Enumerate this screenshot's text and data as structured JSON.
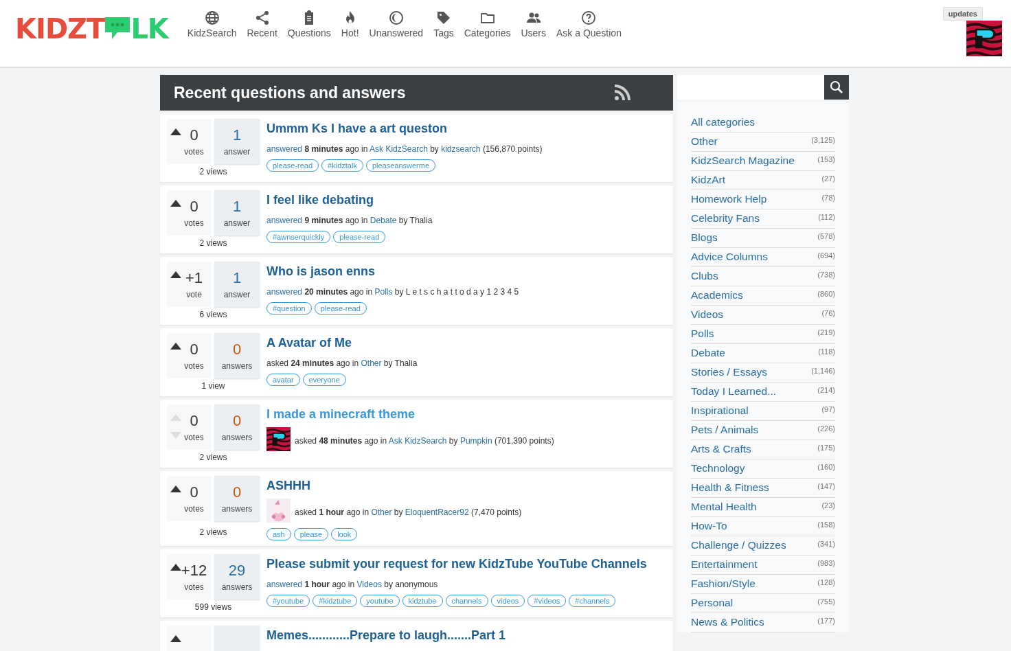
{
  "logo": {
    "left": "KIDZT",
    "right": "LK"
  },
  "nav": [
    {
      "label": "KidzSearch",
      "kind": "globe"
    },
    {
      "label": "Recent",
      "kind": "share"
    },
    {
      "label": "Questions",
      "kind": "clipboard"
    },
    {
      "label": "Hot!",
      "kind": "fire"
    },
    {
      "label": "Unanswered",
      "kind": "moon"
    },
    {
      "label": "Tags",
      "kind": "tag"
    },
    {
      "label": "Categories",
      "kind": "folder"
    },
    {
      "label": "Users",
      "kind": "users"
    },
    {
      "label": "Ask a Question",
      "kind": "question"
    }
  ],
  "updates_button": "updates",
  "user_avatar": {
    "kind": "picture"
  },
  "heading": "Recent questions and answers",
  "questions": [
    {
      "votes": "0",
      "votes_label": "votes",
      "voting_enabled": true,
      "answers": "1",
      "answers_label": "answer",
      "answered": true,
      "views": "2 views",
      "title": "Ummm Ks I have a art queston",
      "visited": false,
      "meta": [
        {
          "text": "answered",
          "kind": "link"
        },
        {
          "text": "8 minutes",
          "kind": "bold"
        },
        {
          "text": "ago in",
          "kind": "plain"
        },
        {
          "text": "Ask KidzSearch",
          "kind": "link"
        },
        {
          "text": "by",
          "kind": "plain"
        },
        {
          "text": "kidzsearch",
          "kind": "link"
        },
        {
          "text": "(156,870 points)",
          "kind": "plain"
        }
      ],
      "tags": [
        "please-read",
        "#kidztalk",
        "pleaseanswerme"
      ]
    },
    {
      "votes": "0",
      "votes_label": "votes",
      "voting_enabled": true,
      "answers": "1",
      "answers_label": "answer",
      "answered": true,
      "views": "2 views",
      "title": "I feel like debating",
      "visited": false,
      "meta": [
        {
          "text": "answered",
          "kind": "link"
        },
        {
          "text": "9 minutes",
          "kind": "bold"
        },
        {
          "text": "ago in",
          "kind": "plain"
        },
        {
          "text": "Debate",
          "kind": "link"
        },
        {
          "text": "by Thalia",
          "kind": "plain"
        }
      ],
      "tags": [
        "#awnserquickly",
        "please-read"
      ]
    },
    {
      "votes": "+1",
      "votes_label": "vote",
      "voting_enabled": true,
      "answers": "1",
      "answers_label": "answer",
      "answered": true,
      "views": "6 views",
      "title": "Who is jason enns",
      "visited": false,
      "meta": [
        {
          "text": "answered",
          "kind": "link"
        },
        {
          "text": "20 minutes",
          "kind": "bold"
        },
        {
          "text": "ago in",
          "kind": "plain"
        },
        {
          "text": "Polls",
          "kind": "link"
        },
        {
          "text": "by L e t s c h a t t o d a y 1 2 3 4 5",
          "kind": "plain"
        }
      ],
      "tags": [
        "#question",
        "please-read"
      ]
    },
    {
      "votes": "0",
      "votes_label": "votes",
      "voting_enabled": true,
      "answers": "0",
      "answers_label": "answers",
      "answered": false,
      "views": "1 view",
      "title": "A Avatar of Me",
      "visited": false,
      "meta": [
        {
          "text": "asked",
          "kind": "plain"
        },
        {
          "text": "24 minutes",
          "kind": "bold"
        },
        {
          "text": "ago in",
          "kind": "plain"
        },
        {
          "text": "Other",
          "kind": "link"
        },
        {
          "text": "by Thalia",
          "kind": "plain"
        }
      ],
      "tags": [
        "avatar",
        "everyone"
      ]
    },
    {
      "votes": "0",
      "votes_label": "votes",
      "voting_enabled": false,
      "answers": "0",
      "answers_label": "answers",
      "answered": false,
      "views": "2 views",
      "title": "I made a minecraft theme",
      "visited": true,
      "avatar": {
        "kind": "picture"
      },
      "meta": [
        {
          "text": "asked",
          "kind": "plain"
        },
        {
          "text": "48 minutes",
          "kind": "bold"
        },
        {
          "text": "ago in",
          "kind": "plain"
        },
        {
          "text": "Ask KidzSearch",
          "kind": "link"
        },
        {
          "text": "by",
          "kind": "plain"
        },
        {
          "text": "Pumpkin",
          "kind": "link"
        },
        {
          "text": "(701,390 points)",
          "kind": "plain"
        }
      ]
    },
    {
      "votes": "0",
      "votes_label": "votes",
      "voting_enabled": true,
      "answers": "0",
      "answers_label": "answers",
      "answered": false,
      "views": "2 views",
      "title": "ASHHH",
      "visited": false,
      "avatar": {
        "kind": "picture"
      },
      "meta": [
        {
          "text": "asked",
          "kind": "plain"
        },
        {
          "text": "1 hour",
          "kind": "bold"
        },
        {
          "text": "ago in",
          "kind": "plain"
        },
        {
          "text": "Other",
          "kind": "link"
        },
        {
          "text": "by",
          "kind": "plain"
        },
        {
          "text": "EloquentRacer92",
          "kind": "link"
        },
        {
          "text": "(7,470 points)",
          "kind": "plain"
        }
      ],
      "tags": [
        "ash",
        "please",
        "look"
      ]
    },
    {
      "votes": "+12",
      "votes_label": "votes",
      "voting_enabled": true,
      "answers": "29",
      "answers_label": "answers",
      "answered": true,
      "views": "599 views",
      "title": "Please submit your request for new KidzTube YouTube Channels",
      "visited": false,
      "meta": [
        {
          "text": "answered",
          "kind": "link"
        },
        {
          "text": "1 hour",
          "kind": "bold"
        },
        {
          "text": "ago in",
          "kind": "plain"
        },
        {
          "text": "Videos",
          "kind": "link"
        },
        {
          "text": "by anonymous",
          "kind": "plain"
        }
      ],
      "tags": [
        "#youtube",
        "#kidztube",
        "youtube",
        "kidztube",
        "channels",
        "videos",
        "#videos",
        "#channels"
      ]
    },
    {
      "voting_enabled": true,
      "title": "Memes............Prepare to laugh.......Part 1",
      "visited": false
    }
  ],
  "categories": [
    {
      "label": "All categories"
    },
    {
      "label": "Other",
      "count": "(3,125)"
    },
    {
      "label": "KidzSearch Magazine",
      "count": "(153)"
    },
    {
      "label": "KidzArt",
      "count": "(27)"
    },
    {
      "label": "Homework Help",
      "count": "(78)"
    },
    {
      "label": "Celebrity Fans",
      "count": "(112)"
    },
    {
      "label": "Blogs",
      "count": "(578)"
    },
    {
      "label": "Advice Columns",
      "count": "(694)"
    },
    {
      "label": "Clubs",
      "count": "(738)"
    },
    {
      "label": "Academics",
      "count": "(860)"
    },
    {
      "label": "Videos",
      "count": "(76)"
    },
    {
      "label": "Polls",
      "count": "(219)"
    },
    {
      "label": "Debate",
      "count": "(118)"
    },
    {
      "label": "Stories / Essays",
      "count": "(1,146)"
    },
    {
      "label": "Today I Learned...",
      "count": "(214)"
    },
    {
      "label": "Inspirational",
      "count": "(97)"
    },
    {
      "label": "Pets / Animals",
      "count": "(226)"
    },
    {
      "label": "Arts & Crafts",
      "count": "(175)"
    },
    {
      "label": "Technology",
      "count": "(160)"
    },
    {
      "label": "Health & Fitness",
      "count": "(147)"
    },
    {
      "label": "Mental Health",
      "count": "(23)"
    },
    {
      "label": "How-To",
      "count": "(158)"
    },
    {
      "label": "Challenge / Quizzes",
      "count": "(341)"
    },
    {
      "label": "Entertainment",
      "count": "(983)"
    },
    {
      "label": "Fashion/Style",
      "count": "(128)"
    },
    {
      "label": "Personal",
      "count": "(755)"
    },
    {
      "label": "News & Politics",
      "count": "(177)"
    }
  ]
}
